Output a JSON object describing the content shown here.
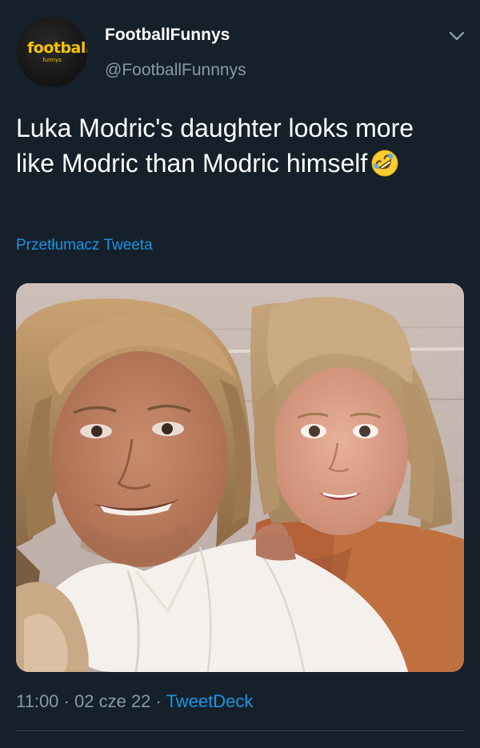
{
  "account": {
    "display_name": "FootballFunnys",
    "handle": "@FootballFunnnys",
    "avatar_logo_text": "football",
    "avatar_logo_subtext": "funnys"
  },
  "tweet": {
    "text": "Luka Modric's daughter looks more like Modric than Modric himself",
    "emoji": "rolling-on-the-floor-laughing-emoji",
    "translate_label": "Przetłumacz Tweeta",
    "media": "photo of a man with long blond hair in a white shirt next to a girl with a blond bob haircut"
  },
  "meta": {
    "time": "11:00",
    "date": "02 cze 22",
    "separator": "·",
    "source": "TweetDeck"
  },
  "icons": {
    "menu": "chevron-down-icon"
  },
  "colors": {
    "background": "#15202b",
    "primary_text": "#ffffff",
    "secondary_text": "#8899a6",
    "link": "#1b95e0",
    "divider": "#38444d"
  }
}
